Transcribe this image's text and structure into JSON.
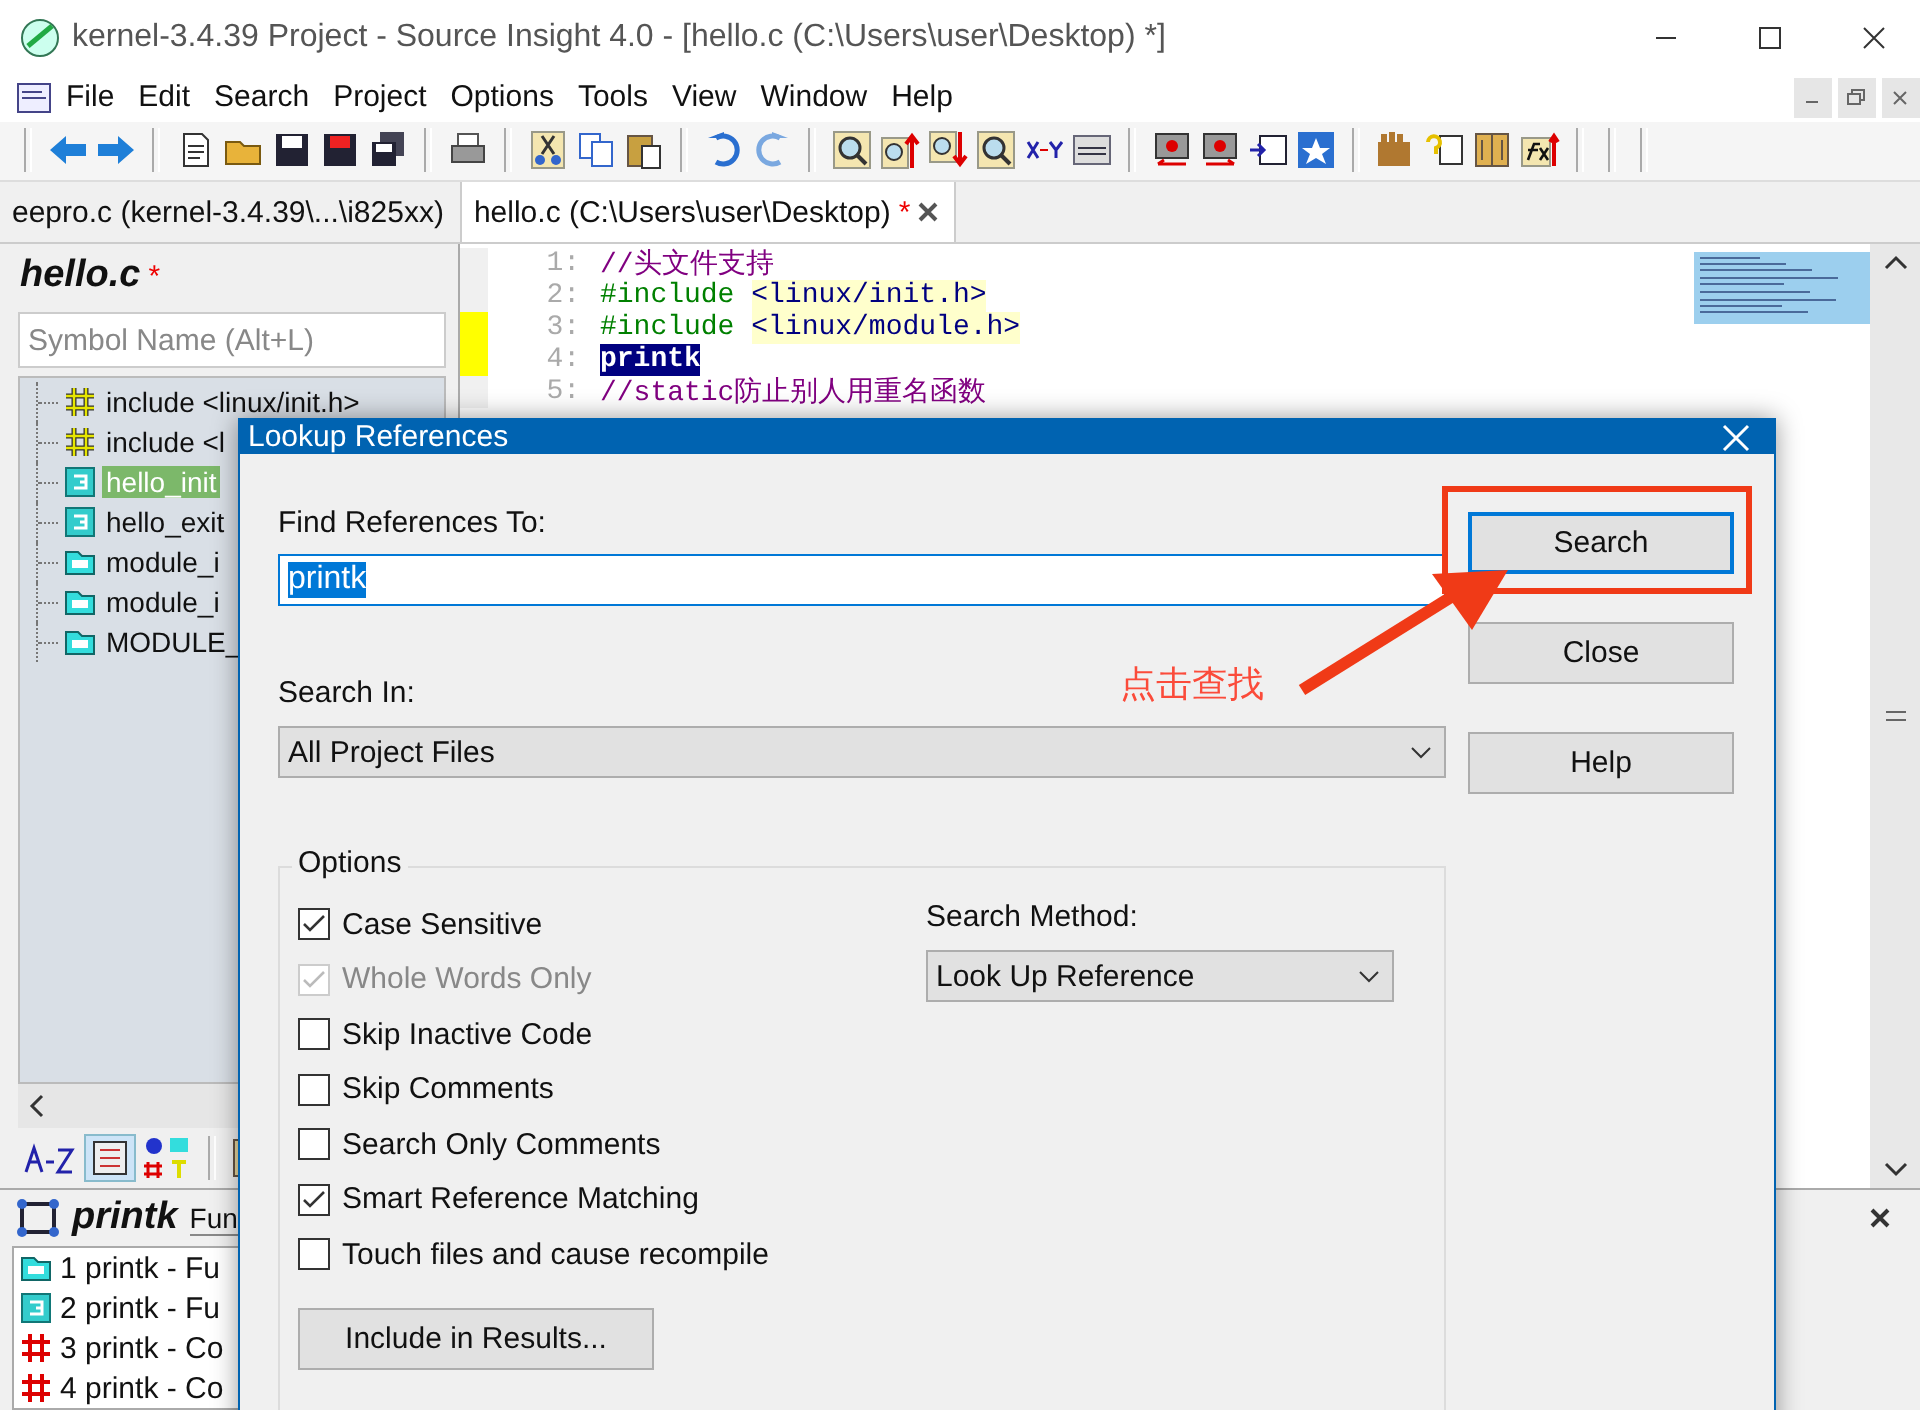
{
  "window": {
    "title": "kernel-3.4.39 Project - Source Insight 4.0 - [hello.c (C:\\Users\\user\\Desktop) *]"
  },
  "menu": [
    "File",
    "Edit",
    "Search",
    "Project",
    "Options",
    "Tools",
    "View",
    "Window",
    "Help"
  ],
  "tabs": [
    {
      "label": "eepro.c (kernel-3.4.39\\...\\i825xx)",
      "selected": false
    },
    {
      "label": "hello.c (C:\\Users\\user\\Desktop)",
      "mark": "*",
      "selected": true
    }
  ],
  "symbol_panel": {
    "file": "hello.c",
    "modified_mark": "*",
    "search": {
      "placeholder": "Symbol Name (Alt+L)"
    },
    "items": [
      {
        "label": "include <linux/init.h>",
        "kind": "include",
        "selected": false
      },
      {
        "label": "include <l",
        "kind": "include",
        "selected": false
      },
      {
        "label": "hello_init",
        "kind": "function",
        "selected": true
      },
      {
        "label": "hello_exit",
        "kind": "function",
        "selected": false
      },
      {
        "label": "module_i",
        "kind": "macro",
        "selected": false
      },
      {
        "label": "module_i",
        "kind": "macro",
        "selected": false
      },
      {
        "label": "MODULE_",
        "kind": "macro",
        "selected": false
      }
    ]
  },
  "editor": {
    "lines": [
      {
        "number": "1:",
        "marked": false,
        "tokens": [
          {
            "text": "//头文件支持",
            "kind": "comment"
          }
        ]
      },
      {
        "number": "2:",
        "marked": false,
        "tokens": [
          {
            "text": "#include ",
            "kind": "directive"
          },
          {
            "text": "<linux/init.h>",
            "kind": "string"
          }
        ]
      },
      {
        "number": "3:",
        "marked": true,
        "tokens": [
          {
            "text": "#include ",
            "kind": "directive"
          },
          {
            "text": "<linux/module.h>",
            "kind": "string"
          }
        ]
      },
      {
        "number": "4:",
        "marked": true,
        "tokens": [
          {
            "text": "printk",
            "kind": "highlight"
          }
        ]
      },
      {
        "number": "5:",
        "marked": false,
        "tokens": [
          {
            "text": "//static防止别人用重名函数",
            "kind": "comment"
          }
        ]
      }
    ]
  },
  "results_panel": {
    "symbol": "printk",
    "type_label": "Fun",
    "items": [
      {
        "label": "1 printk - Fu",
        "kind": "macro"
      },
      {
        "label": "2 printk - Fu",
        "kind": "function"
      },
      {
        "label": "3 printk - Co",
        "kind": "constant"
      },
      {
        "label": "4 printk - Co",
        "kind": "constant"
      }
    ]
  },
  "dialog": {
    "title": "Lookup References",
    "find_label": "Find References To:",
    "find_value": "printk",
    "search_in_label": "Search In:",
    "search_in_value": "All Project Files",
    "options_title": "Options",
    "options": [
      {
        "label": "Case Sensitive",
        "checked": true,
        "disabled": false
      },
      {
        "label": "Whole Words Only",
        "checked": true,
        "disabled": true
      },
      {
        "label": "Skip Inactive Code",
        "checked": false,
        "disabled": false
      },
      {
        "label": "Skip Comments",
        "checked": false,
        "disabled": false
      },
      {
        "label": "Search Only Comments",
        "checked": false,
        "disabled": false
      },
      {
        "label": "Smart Reference Matching",
        "checked": true,
        "disabled": false
      },
      {
        "label": "Touch files and cause recompile",
        "checked": false,
        "disabled": false
      }
    ],
    "method_label": "Search Method:",
    "method_value": "Look Up Reference",
    "buttons": [
      {
        "label": "Search",
        "default": true
      },
      {
        "label": "Close",
        "default": false
      },
      {
        "label": "Help",
        "default": false
      }
    ],
    "include_button": "Include in Results..."
  },
  "annotation": {
    "text": "点击查找"
  }
}
